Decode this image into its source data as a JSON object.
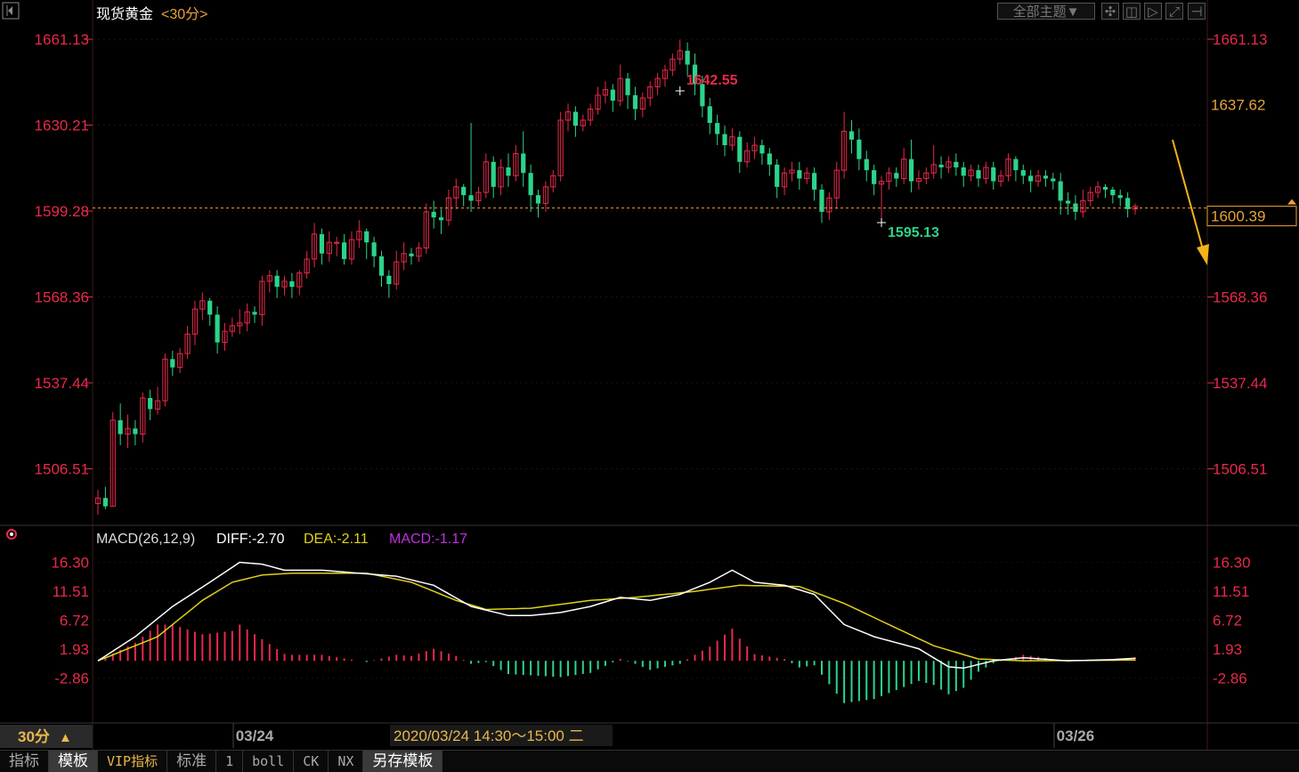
{
  "header": {
    "instrument": "现货黄金",
    "period_tag": "<30分>",
    "theme_button": "全部主题▼"
  },
  "colors": {
    "up": "#e8294a",
    "down": "#2bd48a",
    "price_axis": "#e8294a",
    "current_price_line": "#e8a23a",
    "diff_line": "#ffffff",
    "dea_line": "#e0d21a",
    "macd_label": "#c030e0",
    "arrow": "#f2b21a"
  },
  "chart_data": [
    {
      "type": "candlestick",
      "title": "现货黄金",
      "period": "30分",
      "ylim": [
        1490,
        1665
      ],
      "y_ticks": [
        1661.13,
        1630.21,
        1599.28,
        1568.36,
        1537.44,
        1506.51
      ],
      "y_tick_labels": [
        "1661.13",
        "1630.21",
        "1599.28",
        "1568.36",
        "1537.44",
        "1506.51"
      ],
      "right_axis_labels": [
        "1661.13",
        "1637.62",
        "1600.39",
        "1568.36",
        "1537.44",
        "1506.51"
      ],
      "current_price": 1600.39,
      "current_price_label": "1600.39",
      "right_highlight_value": 1637.62,
      "right_highlight_label": "1637.62",
      "x_tick_labels": [
        "03/24",
        "03/26"
      ],
      "annotations": {
        "high": {
          "index": 78,
          "value": 1642.55,
          "label": "1642.55"
        },
        "low": {
          "index": 105,
          "value": 1595.13,
          "label": "1595.13"
        }
      },
      "candles": [
        [
          1494,
          1496,
          1490,
          1499
        ],
        [
          1496,
          1493,
          1492,
          1500
        ],
        [
          1493,
          1524,
          1493,
          1527
        ],
        [
          1524,
          1519,
          1515,
          1530
        ],
        [
          1519,
          1521,
          1514,
          1526
        ],
        [
          1521,
          1519,
          1515,
          1524
        ],
        [
          1519,
          1532,
          1516,
          1534
        ],
        [
          1532,
          1528,
          1524,
          1535
        ],
        [
          1528,
          1531,
          1526,
          1536
        ],
        [
          1531,
          1546,
          1529,
          1548
        ],
        [
          1546,
          1543,
          1540,
          1549
        ],
        [
          1543,
          1548,
          1541,
          1550
        ],
        [
          1548,
          1555,
          1546,
          1558
        ],
        [
          1555,
          1564,
          1551,
          1567
        ],
        [
          1564,
          1567,
          1560,
          1570
        ],
        [
          1567,
          1562,
          1558,
          1568
        ],
        [
          1562,
          1552,
          1548,
          1565
        ],
        [
          1552,
          1556,
          1549,
          1559
        ],
        [
          1556,
          1558,
          1554,
          1561
        ],
        [
          1558,
          1559,
          1555,
          1564
        ],
        [
          1559,
          1563,
          1556,
          1566
        ],
        [
          1563,
          1562,
          1559,
          1565
        ],
        [
          1562,
          1574,
          1558,
          1576
        ],
        [
          1574,
          1576,
          1570,
          1578
        ],
        [
          1576,
          1572,
          1568,
          1578
        ],
        [
          1572,
          1574,
          1569,
          1576
        ],
        [
          1574,
          1572,
          1568,
          1577
        ],
        [
          1572,
          1577,
          1569,
          1578
        ],
        [
          1577,
          1582,
          1575,
          1585
        ],
        [
          1582,
          1591,
          1579,
          1595
        ],
        [
          1591,
          1584,
          1580,
          1593
        ],
        [
          1584,
          1588,
          1581,
          1592
        ],
        [
          1588,
          1588,
          1583,
          1590
        ],
        [
          1588,
          1582,
          1580,
          1591
        ],
        [
          1582,
          1589,
          1580,
          1592
        ],
        [
          1589,
          1592,
          1586,
          1596
        ],
        [
          1592,
          1588,
          1582,
          1593
        ],
        [
          1588,
          1583,
          1579,
          1590
        ],
        [
          1583,
          1576,
          1572,
          1585
        ],
        [
          1576,
          1573,
          1568,
          1578
        ],
        [
          1573,
          1581,
          1571,
          1585
        ],
        [
          1581,
          1584,
          1578,
          1588
        ],
        [
          1584,
          1583,
          1580,
          1586
        ],
        [
          1583,
          1586,
          1581,
          1588
        ],
        [
          1586,
          1599,
          1584,
          1602
        ],
        [
          1599,
          1597,
          1593,
          1603
        ],
        [
          1597,
          1596,
          1591,
          1600
        ],
        [
          1596,
          1604,
          1594,
          1607
        ],
        [
          1604,
          1608,
          1600,
          1611
        ],
        [
          1608,
          1605,
          1601,
          1609
        ],
        [
          1605,
          1603,
          1599,
          1631
        ],
        [
          1603,
          1606,
          1601,
          1608
        ],
        [
          1606,
          1617,
          1604,
          1620
        ],
        [
          1617,
          1608,
          1604,
          1619
        ],
        [
          1608,
          1615,
          1605,
          1618
        ],
        [
          1615,
          1612,
          1608,
          1620
        ],
        [
          1612,
          1620,
          1610,
          1623
        ],
        [
          1620,
          1613,
          1608,
          1628
        ],
        [
          1613,
          1605,
          1599,
          1616
        ],
        [
          1605,
          1602,
          1597,
          1607
        ],
        [
          1602,
          1608,
          1599,
          1610
        ],
        [
          1608,
          1612,
          1606,
          1614
        ],
        [
          1612,
          1632,
          1610,
          1635
        ],
        [
          1632,
          1635,
          1628,
          1638
        ],
        [
          1635,
          1630,
          1626,
          1637
        ],
        [
          1630,
          1632,
          1628,
          1634
        ],
        [
          1632,
          1636,
          1630,
          1638
        ],
        [
          1636,
          1641,
          1634,
          1644
        ],
        [
          1641,
          1643,
          1638,
          1646
        ],
        [
          1643,
          1639,
          1635,
          1645
        ],
        [
          1639,
          1647,
          1637,
          1652
        ],
        [
          1647,
          1641,
          1636,
          1649
        ],
        [
          1641,
          1636,
          1632,
          1644
        ],
        [
          1636,
          1640,
          1633,
          1642
        ],
        [
          1640,
          1644,
          1637,
          1646
        ],
        [
          1644,
          1647,
          1641,
          1649
        ],
        [
          1647,
          1650,
          1644,
          1652
        ],
        [
          1650,
          1654,
          1648,
          1656
        ],
        [
          1654,
          1657,
          1652,
          1661
        ],
        [
          1657,
          1652,
          1648,
          1660
        ],
        [
          1652,
          1645,
          1641,
          1656
        ],
        [
          1645,
          1637,
          1633,
          1648
        ],
        [
          1637,
          1631,
          1627,
          1640
        ],
        [
          1631,
          1627,
          1623,
          1634
        ],
        [
          1627,
          1623,
          1619,
          1630
        ],
        [
          1623,
          1626,
          1621,
          1629
        ],
        [
          1626,
          1617,
          1613,
          1628
        ],
        [
          1617,
          1621,
          1615,
          1624
        ],
        [
          1621,
          1623,
          1618,
          1626
        ],
        [
          1623,
          1620,
          1616,
          1625
        ],
        [
          1620,
          1616,
          1612,
          1622
        ],
        [
          1616,
          1608,
          1604,
          1618
        ],
        [
          1608,
          1613,
          1605,
          1615
        ],
        [
          1613,
          1614,
          1610,
          1617
        ],
        [
          1614,
          1611,
          1607,
          1617
        ],
        [
          1611,
          1613,
          1609,
          1615
        ],
        [
          1613,
          1607,
          1603,
          1615
        ],
        [
          1607,
          1599,
          1595,
          1609
        ],
        [
          1599,
          1604,
          1596,
          1606
        ],
        [
          1604,
          1614,
          1600,
          1617
        ],
        [
          1614,
          1628,
          1611,
          1635
        ],
        [
          1628,
          1625,
          1620,
          1632
        ],
        [
          1625,
          1618,
          1614,
          1629
        ],
        [
          1618,
          1614,
          1610,
          1621
        ],
        [
          1614,
          1609,
          1605,
          1616
        ],
        [
          1609,
          1610,
          1595,
          1612
        ],
        [
          1610,
          1613,
          1607,
          1615
        ],
        [
          1613,
          1611,
          1608,
          1615
        ],
        [
          1611,
          1618,
          1609,
          1622
        ],
        [
          1618,
          1610,
          1606,
          1625
        ],
        [
          1610,
          1611,
          1607,
          1614
        ],
        [
          1611,
          1613,
          1609,
          1615
        ],
        [
          1613,
          1616,
          1611,
          1623
        ],
        [
          1616,
          1615,
          1611,
          1619
        ],
        [
          1615,
          1617,
          1613,
          1619
        ],
        [
          1617,
          1615,
          1612,
          1620
        ],
        [
          1615,
          1612,
          1608,
          1617
        ],
        [
          1612,
          1614,
          1610,
          1616
        ],
        [
          1614,
          1611,
          1608,
          1616
        ],
        [
          1611,
          1615,
          1609,
          1617
        ],
        [
          1615,
          1610,
          1607,
          1617
        ],
        [
          1610,
          1612,
          1608,
          1614
        ],
        [
          1612,
          1618,
          1610,
          1620
        ],
        [
          1618,
          1614,
          1610,
          1619
        ],
        [
          1614,
          1612,
          1609,
          1616
        ],
        [
          1612,
          1610,
          1606,
          1614
        ],
        [
          1610,
          1612,
          1608,
          1614
        ],
        [
          1612,
          1611,
          1608,
          1614
        ],
        [
          1611,
          1610,
          1607,
          1613
        ],
        [
          1610,
          1603,
          1598,
          1613
        ],
        [
          1603,
          1602,
          1598,
          1606
        ],
        [
          1602,
          1599,
          1596,
          1605
        ],
        [
          1599,
          1603,
          1597,
          1607
        ],
        [
          1603,
          1606,
          1601,
          1608
        ],
        [
          1606,
          1608,
          1604,
          1610
        ],
        [
          1608,
          1607,
          1604,
          1609
        ],
        [
          1607,
          1605,
          1602,
          1608
        ],
        [
          1605,
          1604,
          1601,
          1607
        ],
        [
          1604,
          1600,
          1597,
          1606
        ],
        [
          1600,
          1601,
          1598,
          1602
        ]
      ]
    },
    {
      "type": "macd",
      "title": "MACD(26,12,9)",
      "legend": [
        {
          "label": "DIFF:-2.70",
          "color": "#ffffff"
        },
        {
          "label": "DEA:-2.11",
          "color": "#e0d21a"
        },
        {
          "label": "MACD:-1.17",
          "color": "#c030e0"
        }
      ],
      "ylim": [
        -10,
        18
      ],
      "y_ticks": [
        16.3,
        11.51,
        6.72,
        1.93,
        -2.86
      ],
      "y_tick_labels": [
        "16.30",
        "11.51",
        "6.72",
        "1.93",
        "-2.86"
      ],
      "diff_keypoints": [
        [
          0,
          0
        ],
        [
          5,
          4
        ],
        [
          10,
          9
        ],
        [
          15,
          13
        ],
        [
          19,
          16.3
        ],
        [
          22,
          16
        ],
        [
          25,
          15
        ],
        [
          30,
          15
        ],
        [
          35,
          14.5
        ],
        [
          40,
          14
        ],
        [
          45,
          12.5
        ],
        [
          50,
          9
        ],
        [
          55,
          7.5
        ],
        [
          58,
          7.5
        ],
        [
          62,
          8
        ],
        [
          66,
          9
        ],
        [
          70,
          10.5
        ],
        [
          74,
          10
        ],
        [
          78,
          11
        ],
        [
          82,
          13
        ],
        [
          85,
          15
        ],
        [
          88,
          13
        ],
        [
          92,
          12.5
        ],
        [
          96,
          11
        ],
        [
          100,
          6
        ],
        [
          104,
          4
        ],
        [
          110,
          2
        ],
        [
          114,
          -1
        ],
        [
          116,
          -1.2
        ],
        [
          120,
          0
        ],
        [
          124,
          0.5
        ],
        [
          130,
          0
        ],
        [
          136,
          0.2
        ],
        [
          140,
          0.5
        ],
        [
          145,
          0.5
        ],
        [
          150,
          0
        ],
        [
          155,
          -1
        ],
        [
          160,
          -2
        ],
        [
          165,
          -2.3
        ],
        [
          168,
          -2.7
        ]
      ],
      "dea_keypoints": [
        [
          0,
          0
        ],
        [
          8,
          4
        ],
        [
          14,
          10
        ],
        [
          18,
          13
        ],
        [
          22,
          14.2
        ],
        [
          26,
          14.5
        ],
        [
          36,
          14.5
        ],
        [
          42,
          13
        ],
        [
          48,
          10
        ],
        [
          52,
          8.5
        ],
        [
          58,
          8.7
        ],
        [
          66,
          10
        ],
        [
          72,
          10.5
        ],
        [
          80,
          11.5
        ],
        [
          86,
          12.5
        ],
        [
          94,
          12.3
        ],
        [
          100,
          9.5
        ],
        [
          106,
          6
        ],
        [
          112,
          2.5
        ],
        [
          118,
          0.3
        ],
        [
          124,
          0
        ],
        [
          136,
          0.1
        ],
        [
          145,
          0.2
        ],
        [
          155,
          -0.5
        ],
        [
          162,
          -1.5
        ],
        [
          168,
          -2.11
        ]
      ]
    }
  ],
  "macd_panel": {
    "settings_icon": "gear-icon"
  },
  "footer": {
    "period_label": "30分",
    "period_arrow": "▲",
    "cursor_time": "2020/03/24 14:30～15:00 二"
  },
  "bottom_tabs": [
    {
      "label": "指标"
    },
    {
      "label": "模板"
    },
    {
      "label": "VIP指标"
    },
    {
      "label": "标准"
    },
    {
      "label": "1"
    },
    {
      "label": "boll"
    },
    {
      "label": "CK"
    },
    {
      "label": "NX"
    },
    {
      "label": "另存模板"
    }
  ]
}
